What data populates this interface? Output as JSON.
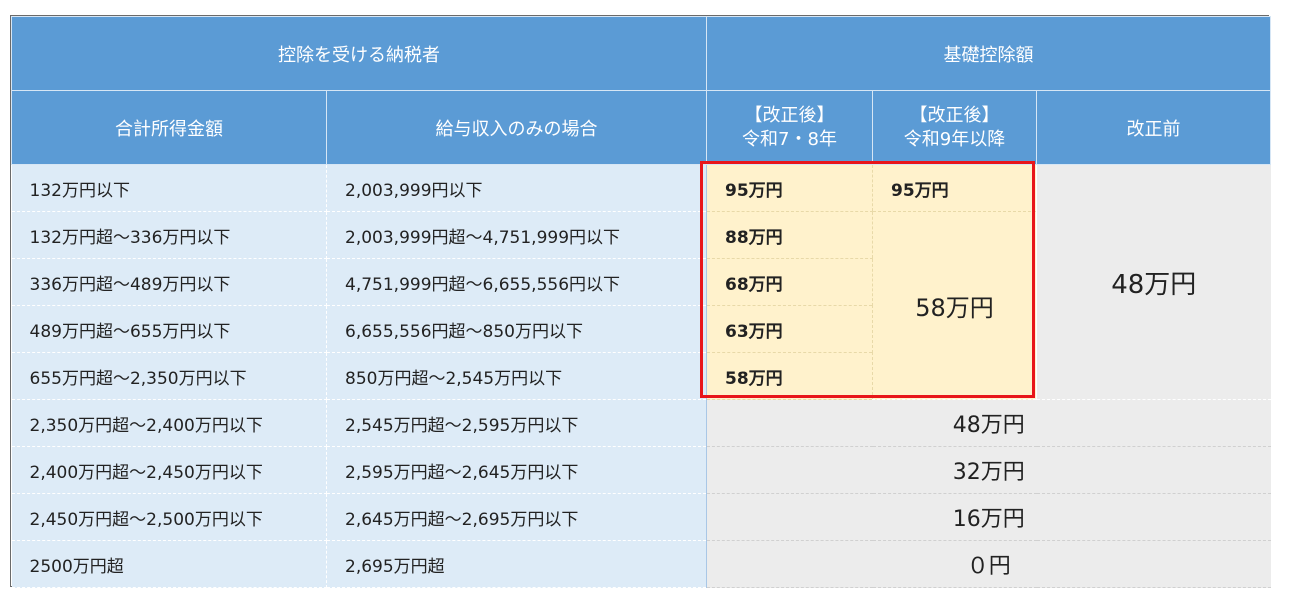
{
  "header": {
    "taxpayer_group": "控除を受ける納税者",
    "deduction_group": "基礎控除額",
    "col_total_income": "合計所得金額",
    "col_salary_only": "給与収入のみの場合",
    "col_r78_line1": "【改正後】",
    "col_r78_line2": "令和7・8年",
    "col_r9_line1": "【改正後】",
    "col_r9_line2": "令和9年以降",
    "col_before": "改正前"
  },
  "rows": [
    {
      "income": "132万円以下",
      "salary": "2,003,999円以下",
      "r78": "95万円",
      "r9": "95万円"
    },
    {
      "income": "132万円超～336万円以下",
      "salary": "2,003,999円超～4,751,999円以下",
      "r78": "88万円"
    },
    {
      "income": "336万円超～489万円以下",
      "salary": "4,751,999円超～6,655,556円以下",
      "r78": "68万円"
    },
    {
      "income": "489万円超～655万円以下",
      "salary": "6,655,556円超～850万円以下",
      "r78": "63万円"
    },
    {
      "income": "655万円超～2,350万円以下",
      "salary": "850万円超～2,545万円以下",
      "r78": "58万円"
    },
    {
      "income": "2,350万円超～2,400万円以下",
      "salary": "2,545万円超～2,595万円以下",
      "common": "48万円"
    },
    {
      "income": "2,400万円超～2,450万円以下",
      "salary": "2,595万円超～2,645万円以下",
      "common": "32万円"
    },
    {
      "income": "2,450万円超～2,500万円以下",
      "salary": "2,645万円超～2,695万円以下",
      "common": "16万円"
    },
    {
      "income": "2500万円超",
      "salary": "2,695万円超",
      "common": "０円"
    }
  ],
  "merged": {
    "r9_shared": "58万円",
    "before_shared": "48万円"
  },
  "colors": {
    "header_blue": "#5b9bd5",
    "light_blue": "#ddebf7",
    "highlight_yellow": "#fff2cc",
    "gray": "#ececec",
    "highlight_border": "#e8161a"
  }
}
